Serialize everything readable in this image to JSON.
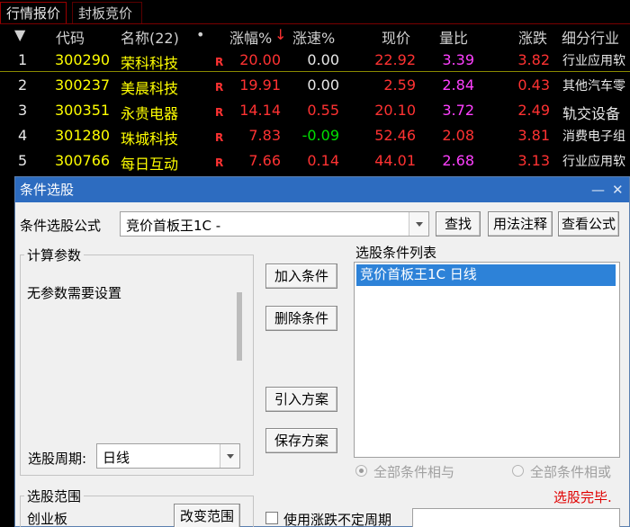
{
  "tabs": [
    {
      "label": "行情报价"
    },
    {
      "label": "封板竞价"
    }
  ],
  "quote_header": {
    "arrow": "▼",
    "code": "代码",
    "name": "名称(22)",
    "dot": "•",
    "change_pct": "涨幅%",
    "sort_arrow": "↓",
    "speed": "涨速%",
    "price": "现价",
    "volume_ratio": "量比",
    "change": "涨跌",
    "industry": "细分行业"
  },
  "quotes": [
    {
      "rank": "1",
      "code": "300290",
      "name": "荣科科技",
      "flag": "R",
      "change_pct": "20.00",
      "speed": "0.00",
      "price": "22.92",
      "volume_ratio": "3.39",
      "change": "3.82",
      "industry": "行业应用软"
    },
    {
      "rank": "2",
      "code": "300237",
      "name": "美晨科技",
      "flag": "R",
      "change_pct": "19.91",
      "speed": "0.00",
      "price": "2.59",
      "volume_ratio": "2.84",
      "change": "0.43",
      "industry": "其他汽车零"
    },
    {
      "rank": "3",
      "code": "300351",
      "name": "永贵电器",
      "flag": "R",
      "change_pct": "14.14",
      "speed": "0.55",
      "price": "20.10",
      "volume_ratio": "3.72",
      "change": "2.49",
      "industry": "轨交设备"
    },
    {
      "rank": "4",
      "code": "301280",
      "name": "珠城科技",
      "flag": "R",
      "change_pct": "7.83",
      "speed": "-0.09",
      "price": "52.46",
      "volume_ratio": "2.08",
      "change": "3.81",
      "industry": "消费电子组"
    },
    {
      "rank": "5",
      "code": "300766",
      "name": "每日互动",
      "flag": "R",
      "change_pct": "7.66",
      "speed": "0.14",
      "price": "44.01",
      "volume_ratio": "2.68",
      "change": "3.13",
      "industry": "行业应用软"
    }
  ],
  "dialog": {
    "title": "条件选股",
    "minimize": "—",
    "close": "✕",
    "formula_label": "条件选股公式",
    "formula_value": "竞价首板王1C  -",
    "find_button": "查找",
    "usage_button": "用法注释",
    "view_button": "查看公式",
    "params_group": "计算参数",
    "params_text": "无参数需要设置",
    "add_button": "加入条件",
    "delete_button": "删除条件",
    "import_button": "引入方案",
    "save_button": "保存方案",
    "list_title": "选股条件列表",
    "list_items": [
      "竞价首板王1C  日线"
    ],
    "period_label": "选股周期:",
    "period_value": "日线",
    "radio_and": "全部条件相与",
    "radio_or": "全部条件相或",
    "status": "选股完毕.",
    "range_group": "选股范围",
    "range_value": "创业板",
    "change_range_button": "改变范围",
    "use_period_checkbox": "使用涨跌不定周期"
  },
  "colors": {
    "up": "#ff3232",
    "down": "#00e000",
    "code": "#ffff00",
    "name": "#ffff00",
    "volume_ratio": "#ff40ff",
    "title_bar": "#2d6cc0",
    "list_selection": "#2d82d8"
  }
}
